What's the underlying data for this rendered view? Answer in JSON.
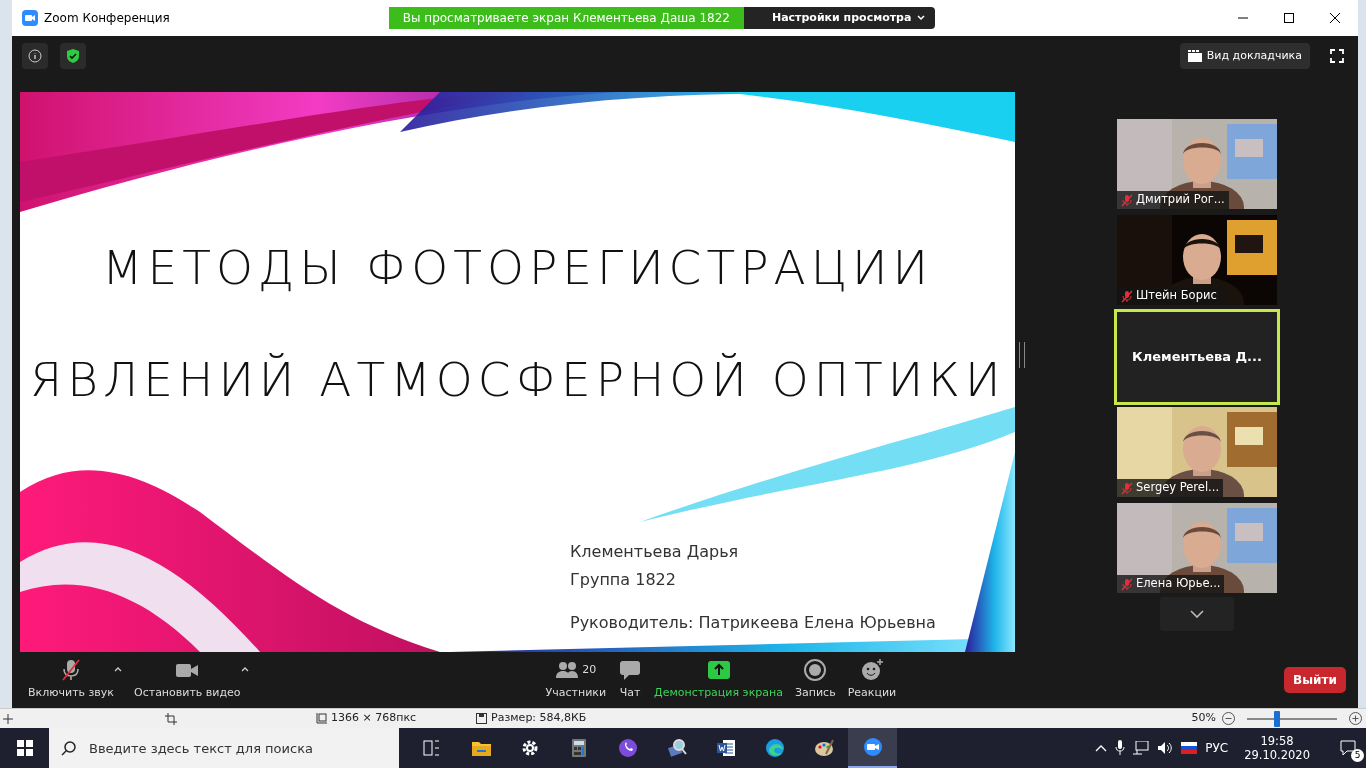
{
  "window": {
    "title": "Zoom Конференция"
  },
  "share_banner": {
    "text": "Вы просматриваете экран Клементьева Даша 1822",
    "settings": "Настройки просмотра"
  },
  "top_bar": {
    "view_button": "Вид докладчика"
  },
  "slide": {
    "title_lines": [
      "МЕТОДЫ ФОТОРЕГИСТРАЦИИ",
      "ЯВЛЕНИЙ АТМОСФЕРНОЙ ОПТИКИ"
    ],
    "author_lines": [
      "Клементьева Дарья",
      "Группа 1822"
    ],
    "supervisor": "Руководитель: Патрикеева Елена Юрьевна"
  },
  "participants": [
    {
      "name": "Дмитрий Рог...",
      "kind": "video",
      "muted": true,
      "active_speaker": false
    },
    {
      "name": "Штейн Борис",
      "kind": "video",
      "muted": true,
      "active_speaker": false
    },
    {
      "name": "Клементьева Д...",
      "kind": "name",
      "muted": false,
      "active_speaker": true
    },
    {
      "name": "Sergey Perel...",
      "kind": "video",
      "muted": true,
      "active_speaker": false
    },
    {
      "name": "Елена Юрье...",
      "kind": "video",
      "muted": true,
      "active_speaker": false
    }
  ],
  "toolbar": {
    "items": [
      {
        "kind": "mic",
        "label": "Включить звук",
        "muted": true,
        "menu": true,
        "active": false
      },
      {
        "kind": "camera",
        "label": "Остановить видео",
        "menu": true,
        "active": false
      },
      {
        "kind": "participants",
        "label": "Участники",
        "count": "20",
        "active": false
      },
      {
        "kind": "chat",
        "label": "Чат",
        "active": false
      },
      {
        "kind": "share",
        "label": "Демонстрация экрана",
        "active": true
      },
      {
        "kind": "record",
        "label": "Запись",
        "active": false
      },
      {
        "kind": "reactions",
        "label": "Реакции",
        "active": false
      }
    ],
    "leave": "Выйти"
  },
  "viewer_status": {
    "dimensions": "1366 × 768пкс",
    "size": "Размер: 584,8КБ",
    "zoom": "50%",
    "zoom_slider": {
      "level": 0.3
    }
  },
  "taskbar": {
    "search_placeholder": "Введите здесь текст для поиска",
    "apps": [
      {
        "kind": "taskview",
        "selected": false
      },
      {
        "kind": "folder",
        "selected": false
      },
      {
        "kind": "gear",
        "selected": false
      },
      {
        "kind": "calculator",
        "selected": false
      },
      {
        "kind": "viber",
        "selected": false
      },
      {
        "kind": "magnifier",
        "selected": false
      },
      {
        "kind": "word",
        "selected": false
      },
      {
        "kind": "edge",
        "selected": false
      },
      {
        "kind": "palette",
        "selected": false
      },
      {
        "kind": "zoom",
        "selected": true
      }
    ],
    "language": "РУС",
    "time": "19:58",
    "date": "29.10.2020",
    "notifications": "5"
  }
}
